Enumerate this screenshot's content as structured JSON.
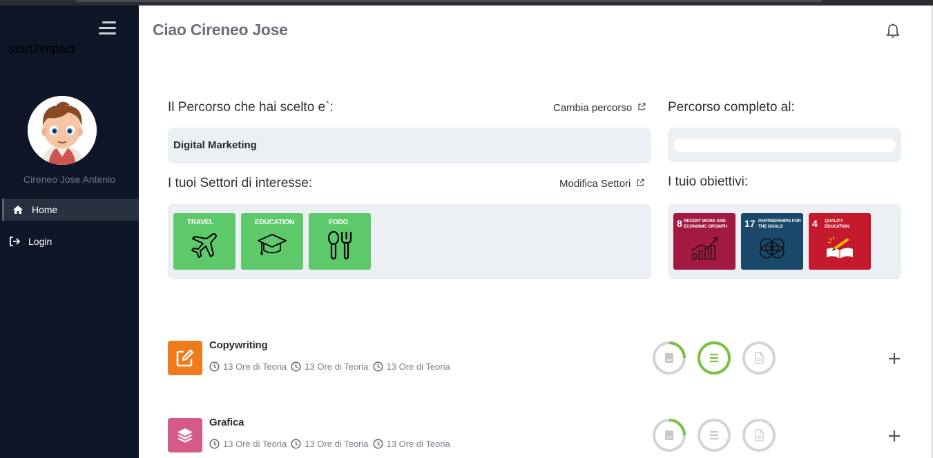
{
  "sidebar": {
    "brand": "start2impact",
    "user_name": "Cireneo Jose Antenio",
    "nav": [
      {
        "label": "Home",
        "icon": "home-icon",
        "active": true
      },
      {
        "label": "Login",
        "icon": "login-icon",
        "active": false
      }
    ]
  },
  "header": {
    "greeting": "Ciao Cireneo Jose",
    "notification_icon": "bell-icon"
  },
  "path": {
    "title": "Il Percorso che hai scelto e`:",
    "change_link": "Cambia percorso",
    "value": "Digital Marketing",
    "progress_title": "Percorso completo al:",
    "progress_fraction": 0
  },
  "interests": {
    "title": "I tuoi Settori di interesse:",
    "edit_link": "Modifica Settori",
    "sectors": [
      {
        "label": "TRAVEL",
        "icon": "airplane-icon"
      },
      {
        "label": "EDUCATION",
        "icon": "graduation-cap-icon"
      },
      {
        "label": "FODO",
        "icon": "fork-spoon-icon"
      }
    ]
  },
  "goals": {
    "title": "I tuio obiettivi:",
    "items": [
      {
        "number": "8",
        "text": "RECENT WORK AND ECONOMIC GROWTH",
        "color": "#a21942",
        "icon": "growth-chart-icon"
      },
      {
        "number": "17",
        "text": "PARTNERSHIPS FOR THE GOALS",
        "color": "#19486a",
        "icon": "partnership-rings-icon"
      },
      {
        "number": "4",
        "text": "QUALITY EDUCATION",
        "color": "#c5192d",
        "icon": "book-pencil-icon"
      }
    ]
  },
  "courses": [
    {
      "title": "Copywriting",
      "icon": "edit-icon",
      "color": "#f07b1d",
      "meta": [
        "13 Ore di Teoria",
        "13 Ore di Teoria",
        "13 Ore di Teoria"
      ],
      "progress": [
        0.25,
        1,
        0
      ]
    },
    {
      "title": "Grafica",
      "icon": "layers-icon",
      "color": "#d45b87",
      "meta": [
        "13 Ore di Teoria",
        "13 Ore di Teoria",
        "13 Ore di Teoria"
      ],
      "progress": [
        0.25,
        0,
        0
      ]
    }
  ],
  "colors": {
    "sidebar_bg": "#0e1628",
    "sector_green": "#5ec96a",
    "progress_green": "#7ac143",
    "ring_gray": "#d4d4d4"
  }
}
